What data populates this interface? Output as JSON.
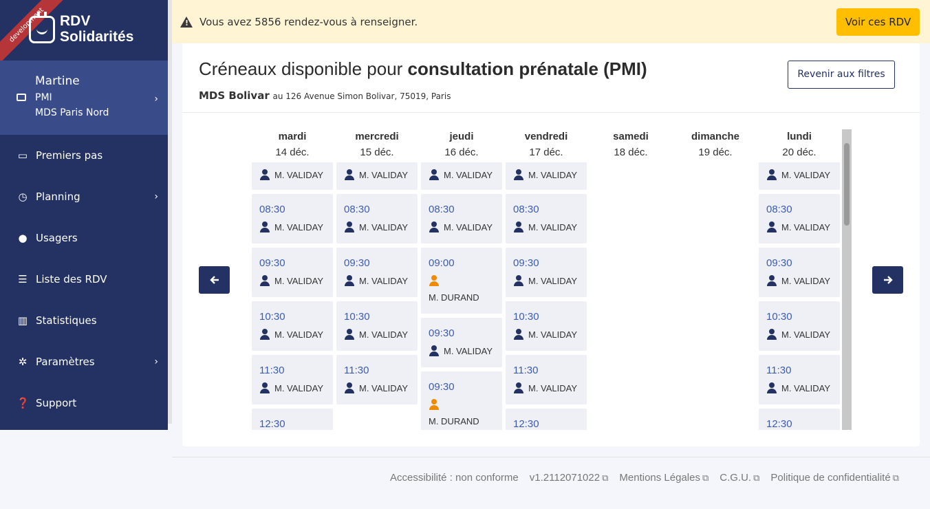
{
  "env_ribbon": "development",
  "brand": {
    "line1": "RDV",
    "line2": "Solidarités"
  },
  "org": {
    "agent": "Martine",
    "service": "PMI",
    "place": "MDS Paris Nord"
  },
  "nav": [
    {
      "label": "Premiers pas",
      "icon": "calendar-icon",
      "chev": false
    },
    {
      "label": "Planning",
      "icon": "clock-icon",
      "chev": true
    },
    {
      "label": "Usagers",
      "icon": "user-icon",
      "chev": false
    },
    {
      "label": "Liste des RDV",
      "icon": "list-icon",
      "chev": false
    },
    {
      "label": "Statistiques",
      "icon": "chart-icon",
      "chev": false
    },
    {
      "label": "Paramètres",
      "icon": "gear-icon",
      "chev": true
    },
    {
      "label": "Support",
      "icon": "question-icon",
      "chev": false
    }
  ],
  "banner": {
    "text": "Vous avez 5856 rendez-vous à renseigner.",
    "button": "Voir ces RDV"
  },
  "card": {
    "title_prefix": "Créneaux disponible pour",
    "title_bold": "consultation prénatale (PMI)",
    "place_name": "MDS Bolivar",
    "place_address": "au 126 Avenue Simon Bolivar, 75019, Paris",
    "reset_button": "Revenir aux filtres"
  },
  "days": [
    {
      "name": "mardi",
      "date": "14 déc.",
      "slots": [
        {
          "time": "",
          "agent": "M. VALIDAY",
          "orange": false
        },
        {
          "time": "08:30",
          "agent": "M. VALIDAY",
          "orange": false
        },
        {
          "time": "09:30",
          "agent": "M. VALIDAY",
          "orange": false
        },
        {
          "time": "10:30",
          "agent": "M. VALIDAY",
          "orange": false
        },
        {
          "time": "11:30",
          "agent": "M. VALIDAY",
          "orange": false
        },
        {
          "time": "12:30",
          "agent": "",
          "orange": false
        }
      ]
    },
    {
      "name": "mercredi",
      "date": "15 déc.",
      "slots": [
        {
          "time": "",
          "agent": "M. VALIDAY",
          "orange": false
        },
        {
          "time": "08:30",
          "agent": "M. VALIDAY",
          "orange": false
        },
        {
          "time": "09:30",
          "agent": "M. VALIDAY",
          "orange": false
        },
        {
          "time": "10:30",
          "agent": "M. VALIDAY",
          "orange": false
        },
        {
          "time": "11:30",
          "agent": "M. VALIDAY",
          "orange": false
        }
      ]
    },
    {
      "name": "jeudi",
      "date": "16 déc.",
      "slots": [
        {
          "time": "",
          "agent": "M. VALIDAY",
          "orange": false
        },
        {
          "time": "08:30",
          "agent": "M. VALIDAY",
          "orange": false
        },
        {
          "time": "09:00",
          "agent": "M. DURAND",
          "orange": true
        },
        {
          "time": "09:30",
          "agent": "M. VALIDAY",
          "orange": false
        },
        {
          "time": "09:30",
          "agent": "M. DURAND",
          "orange": true
        }
      ]
    },
    {
      "name": "vendredi",
      "date": "17 déc.",
      "slots": [
        {
          "time": "",
          "agent": "M. VALIDAY",
          "orange": false
        },
        {
          "time": "08:30",
          "agent": "M. VALIDAY",
          "orange": false
        },
        {
          "time": "09:30",
          "agent": "M. VALIDAY",
          "orange": false
        },
        {
          "time": "10:30",
          "agent": "M. VALIDAY",
          "orange": false
        },
        {
          "time": "11:30",
          "agent": "M. VALIDAY",
          "orange": false
        },
        {
          "time": "12:30",
          "agent": "",
          "orange": false
        }
      ]
    },
    {
      "name": "samedi",
      "date": "18 déc.",
      "slots": []
    },
    {
      "name": "dimanche",
      "date": "19 déc.",
      "slots": []
    },
    {
      "name": "lundi",
      "date": "20 déc.",
      "slots": [
        {
          "time": "",
          "agent": "M. VALIDAY",
          "orange": false
        },
        {
          "time": "08:30",
          "agent": "M. VALIDAY",
          "orange": false
        },
        {
          "time": "09:30",
          "agent": "M. VALIDAY",
          "orange": false
        },
        {
          "time": "10:30",
          "agent": "M. VALIDAY",
          "orange": false
        },
        {
          "time": "11:30",
          "agent": "M. VALIDAY",
          "orange": false
        },
        {
          "time": "12:30",
          "agent": "",
          "orange": false
        }
      ]
    }
  ],
  "footer": [
    {
      "label": "Accessibilité : non conforme",
      "external": false
    },
    {
      "label": "v1.2112071022",
      "external": true
    },
    {
      "label": "Mentions Légales",
      "external": true
    },
    {
      "label": "C.G.U.",
      "external": true
    },
    {
      "label": "Politique de confidentialité",
      "external": true
    }
  ],
  "colors": {
    "sidebar": "#233163",
    "accent": "#3d5bb3",
    "banner": "#fff5d5",
    "warn_button": "#ffbf00",
    "orange": "#f08a00"
  }
}
